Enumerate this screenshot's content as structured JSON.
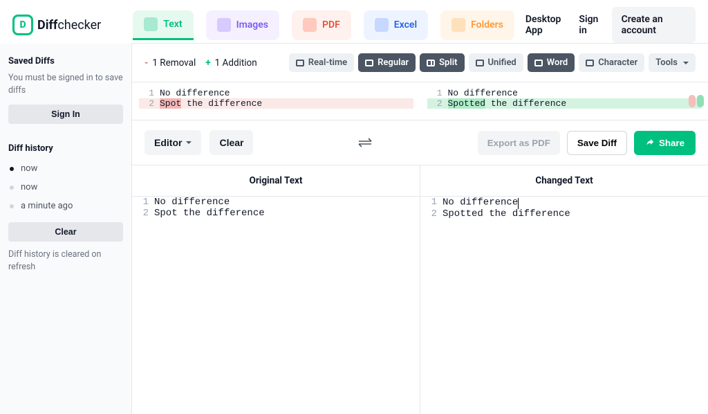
{
  "brand": {
    "diff": "Diff",
    "checker": "checker",
    "mark": "D"
  },
  "nav": {
    "text": "Text",
    "images": "Images",
    "pdf": "PDF",
    "excel": "Excel",
    "folders": "Folders",
    "desktop": "Desktop App",
    "signin": "Sign in",
    "create": "Create an account"
  },
  "sidebar": {
    "saved_title": "Saved Diffs",
    "saved_note": "You must be signed in to save diffs",
    "signin": "Sign In",
    "history_title": "Diff history",
    "history": [
      "now",
      "now",
      "a minute ago"
    ],
    "clear": "Clear",
    "clear_note": "Diff history is cleared on refresh"
  },
  "toolbar": {
    "removal": "1 Removal",
    "addition": "1 Addition",
    "realtime": "Real-time",
    "regular": "Regular",
    "split": "Split",
    "unified": "Unified",
    "word": "Word",
    "character": "Character",
    "tools": "Tools"
  },
  "diff": {
    "left": [
      {
        "n": "1",
        "plain": "No difference"
      },
      {
        "n": "2",
        "hl": "Spot",
        "rest": " the difference",
        "bg": "red"
      }
    ],
    "right": [
      {
        "n": "1",
        "plain": "No difference"
      },
      {
        "n": "2",
        "hl": "Spotted",
        "rest": " the difference",
        "bg": "green"
      }
    ]
  },
  "editbar": {
    "editor": "Editor",
    "clear": "Clear",
    "export": "Export as PDF",
    "save": "Save Diff",
    "share": "Share"
  },
  "panes": {
    "left_title": "Original Text",
    "right_title": "Changed Text",
    "left": [
      {
        "n": "1",
        "t": "No difference"
      },
      {
        "n": "2",
        "t": "Spot the difference"
      }
    ],
    "right": [
      {
        "n": "1",
        "t": "No difference"
      },
      {
        "n": "2",
        "t": "Spotted the difference"
      }
    ]
  }
}
